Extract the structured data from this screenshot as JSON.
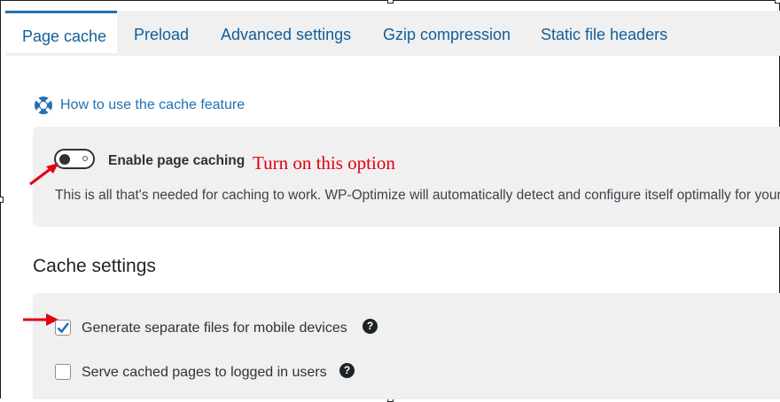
{
  "tabs": [
    {
      "label": "Page cache",
      "active": true
    },
    {
      "label": "Preload",
      "active": false
    },
    {
      "label": "Advanced settings",
      "active": false
    },
    {
      "label": "Gzip compression",
      "active": false
    },
    {
      "label": "Static file headers",
      "active": false
    }
  ],
  "help_link": {
    "label": "How to use the cache feature",
    "icon": "lifebuoy-icon"
  },
  "enable_caching": {
    "label": "Enable page caching",
    "enabled": false,
    "description": "This is all that's needed for caching to work. WP-Optimize will automatically detect and configure itself optimally for your site."
  },
  "annotation": {
    "text": "Turn on this option",
    "color": "#e3000f"
  },
  "cache_settings": {
    "title": "Cache settings",
    "options": [
      {
        "label": "Generate separate files for mobile devices",
        "checked": true,
        "help_icon": "question-icon"
      },
      {
        "label": "Serve cached pages to logged in users",
        "checked": false,
        "help_icon": "question-icon"
      }
    ]
  },
  "colors": {
    "accent": "#2271b1",
    "annotation_red": "#e3000f",
    "panel_bg": "#f0f0f1"
  }
}
